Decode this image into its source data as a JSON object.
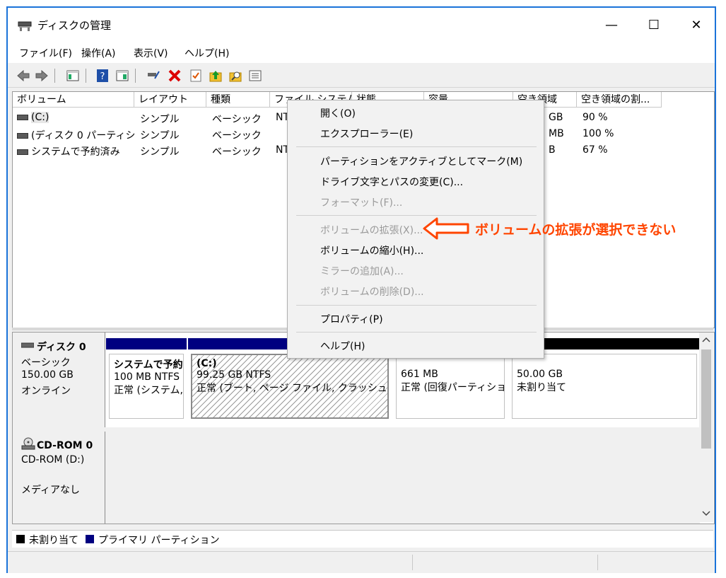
{
  "window": {
    "title": "ディスクの管理"
  },
  "window_controls": {
    "minimize": "—",
    "maximize": "☐",
    "close": "✕"
  },
  "menu": [
    "ファイル(F)",
    "操作(A)",
    "表示(V)",
    "ヘルプ(H)"
  ],
  "volume_list": {
    "columns": [
      "ボリューム",
      "レイアウト",
      "種類",
      "ファイル システム",
      "状態",
      "容量",
      "空き領域",
      "空き領域の割..."
    ],
    "rows": [
      {
        "name": "(C:)",
        "layout": "シンプル",
        "type": "ベーシック",
        "fs": "NT",
        "free": "GB",
        "pct": "90 %"
      },
      {
        "name": "(ディスク 0 パーティシ...",
        "layout": "シンプル",
        "type": "ベーシック",
        "fs": "",
        "free": "MB",
        "pct": "100 %"
      },
      {
        "name": "システムで予約済み",
        "layout": "シンプル",
        "type": "ベーシック",
        "fs": "NT",
        "free": "B",
        "pct": "67 %"
      }
    ]
  },
  "disks": [
    {
      "name": "ディスク 0",
      "type": "ベーシック",
      "size": "150.00 GB",
      "status": "オンライン",
      "partitions": [
        {
          "label": "システムで予約",
          "size": "100 MB NTFS",
          "status": "正常 (システム,"
        },
        {
          "label": "(C:)",
          "size": "99.25 GB NTFS",
          "status": "正常 (ブート, ページ ファイル, クラッシュ ダンプ"
        },
        {
          "label": "",
          "size": "661 MB",
          "status": "正常 (回復パーティショ"
        },
        {
          "label": "",
          "size": "50.00 GB",
          "status": "未割り当て"
        }
      ]
    },
    {
      "name": "CD-ROM 0",
      "type": "CD-ROM (D:)",
      "status": "メディアなし"
    }
  ],
  "legend": {
    "unallocated": "未割り当て",
    "primary": "プライマリ パーティション"
  },
  "context_menu": [
    {
      "label": "開く(O)",
      "enabled": true
    },
    {
      "label": "エクスプローラー(E)",
      "enabled": true
    },
    {
      "label": "パーティションをアクティブとしてマーク(M)",
      "enabled": true
    },
    {
      "label": "ドライブ文字とパスの変更(C)...",
      "enabled": true
    },
    {
      "label": "フォーマット(F)...",
      "enabled": false
    },
    {
      "label": "ボリュームの拡張(X)...",
      "enabled": false
    },
    {
      "label": "ボリュームの縮小(H)...",
      "enabled": true
    },
    {
      "label": "ミラーの追加(A)...",
      "enabled": false
    },
    {
      "label": "ボリュームの削除(D)...",
      "enabled": false
    },
    {
      "label": "プロパティ(P)",
      "enabled": true
    },
    {
      "label": "ヘルプ(H)",
      "enabled": true
    }
  ],
  "annotation": {
    "text": "ボリュームの拡張が選択できない",
    "color": "#ff4500"
  },
  "colors": {
    "primary_partition": "#000080",
    "unallocated": "#000000",
    "window_border": "#1a73d9"
  }
}
